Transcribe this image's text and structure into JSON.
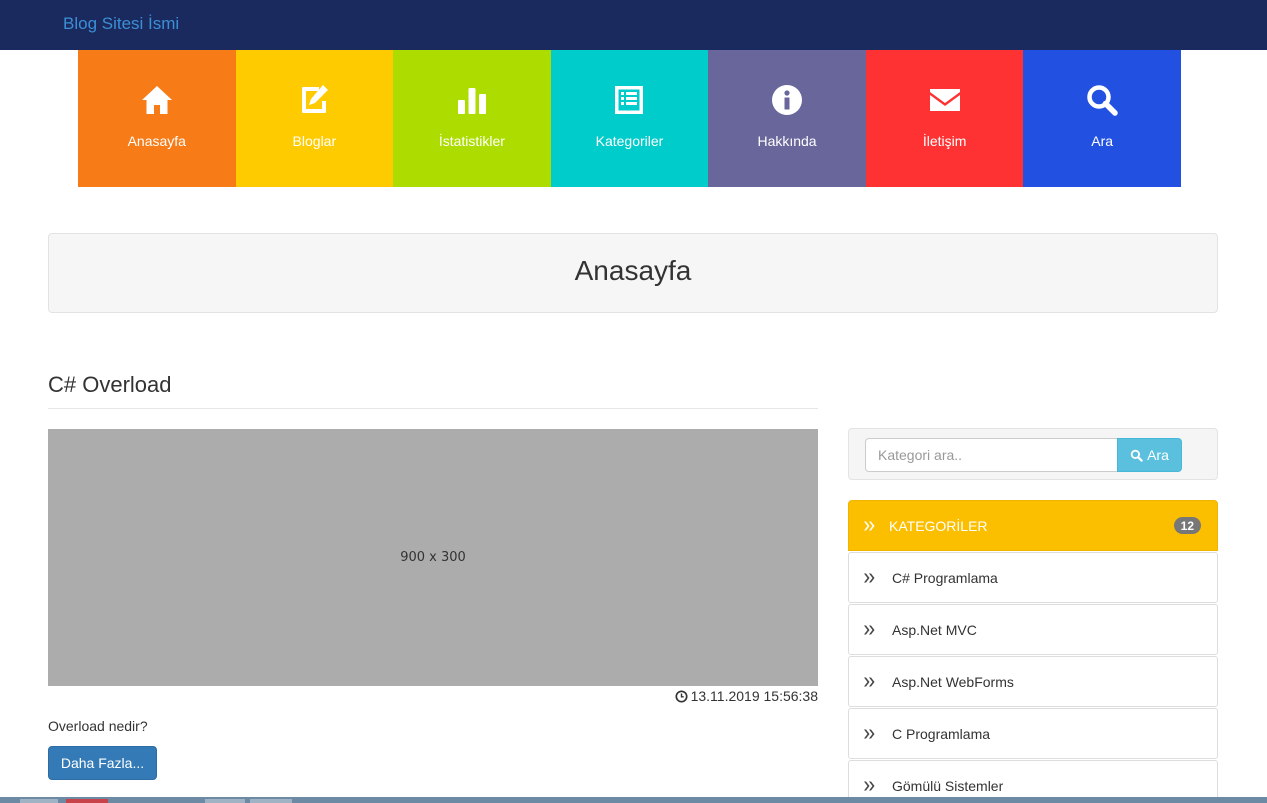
{
  "navbar": {
    "brand": "Blog Sitesi İsmi"
  },
  "tiles": [
    {
      "label": "Anasayfa",
      "icon": "home-icon",
      "color": "#f77b17"
    },
    {
      "label": "Bloglar",
      "icon": "edit-icon",
      "color": "#fecb00"
    },
    {
      "label": "İstatistikler",
      "icon": "bar-chart-icon",
      "color": "#acdc00"
    },
    {
      "label": "Kategoriler",
      "icon": "list-icon",
      "color": "#00cccb"
    },
    {
      "label": "Hakkında",
      "icon": "info-icon",
      "color": "#68669a"
    },
    {
      "label": "İletişim",
      "icon": "envelope-icon",
      "color": "#fe3232"
    },
    {
      "label": "Ara",
      "icon": "search-icon",
      "color": "#2251e1"
    }
  ],
  "page": {
    "title": "Anasayfa"
  },
  "post": {
    "title": "C# Overload",
    "image_placeholder": "900 x 300",
    "date": "13.11.2019 15:56:38",
    "excerpt": "Overload nedir?",
    "more_label": "Daha Fazla..."
  },
  "search": {
    "placeholder": "Kategori ara..",
    "button_label": "Ara"
  },
  "categories": {
    "header": "KATEGORİLER",
    "count": "12",
    "items": [
      "C# Programlama",
      "Asp.Net MVC",
      "Asp.Net WebForms",
      "C Programlama",
      "Gömülü Sistemler"
    ]
  },
  "colors": {
    "navbar": "#1b2a5e",
    "brand": "#3b8fd6",
    "primary_button": "#337ab7",
    "search_button": "#5bc0de",
    "category_header": "#fcbf00"
  }
}
